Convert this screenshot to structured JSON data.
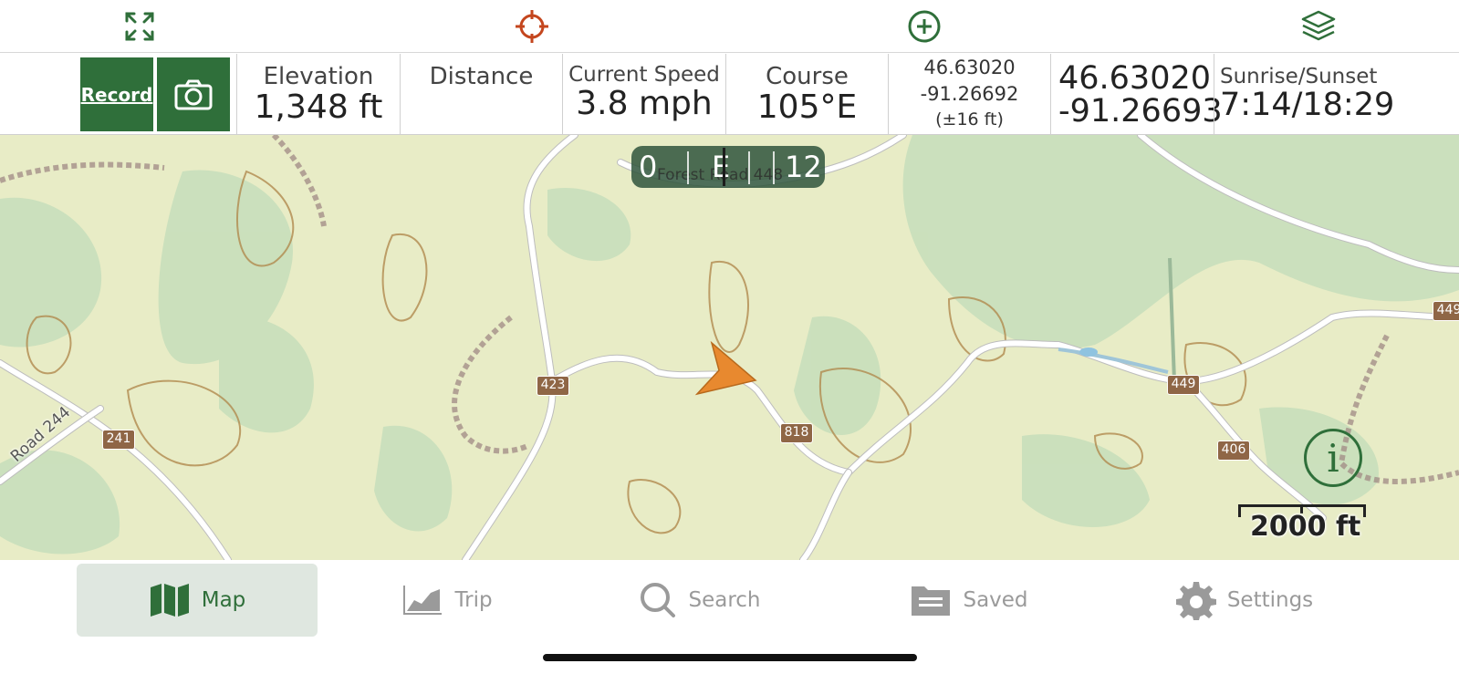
{
  "toolbar": {
    "expand_icon": "expand-arrows-icon",
    "locate_icon": "crosshair-icon",
    "add_icon": "add-circle-icon",
    "layers_icon": "layers-icon",
    "colors": {
      "locate": "#c4461e",
      "green": "#2f6f3a"
    }
  },
  "stats": {
    "record_label": "Record",
    "camera_icon": "camera-icon",
    "elevation_label": "Elevation",
    "elevation_value": "1,348 ft",
    "distance_label": "Distance",
    "speed_label": "Current Speed",
    "speed_value": "3.8 mph",
    "course_label": "Course",
    "course_value": "105°E",
    "gps_lat": "46.63020",
    "gps_lon": "-91.26692",
    "gps_accuracy": "(±16 ft)",
    "lat": "46.63020",
    "lon": "-91.26693",
    "sun_label": "Sunrise/Sunset",
    "sun_value": "7:14/18:29"
  },
  "map": {
    "compass": {
      "left": "0",
      "mid": "E",
      "right": "12"
    },
    "compass_road": "Forest Road 448",
    "road_shields": [
      "423",
      "241",
      "818",
      "449",
      "406",
      "449"
    ],
    "road_label": "Road 244",
    "scale_label": "2000 ft",
    "info_icon": "info-icon",
    "colors": {
      "land": "#e8ecc6",
      "forest": "#c5ddb8",
      "contour": "#b08a4e",
      "road": "#ffffff",
      "shield": "#8f6646",
      "arrow": "#e8892f"
    }
  },
  "tabs": [
    {
      "label": "Map",
      "icon": "map-icon",
      "active": true
    },
    {
      "label": "Trip",
      "icon": "trip-chart-icon",
      "active": false
    },
    {
      "label": "Search",
      "icon": "search-icon",
      "active": false
    },
    {
      "label": "Saved",
      "icon": "folder-icon",
      "active": false
    },
    {
      "label": "Settings",
      "icon": "gear-icon",
      "active": false
    }
  ]
}
